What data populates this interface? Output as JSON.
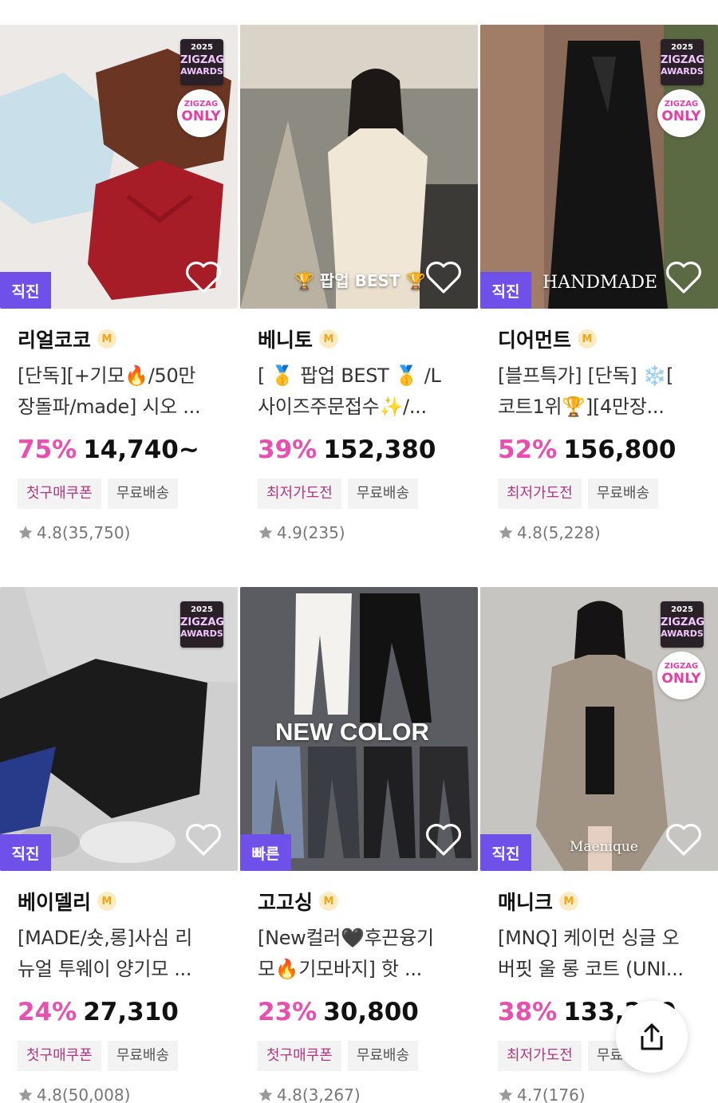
{
  "products": [
    {
      "store": "리얼코코",
      "title_lines": [
        "[단독][+기모🔥/50만",
        "장돌파/made] 시오 ..."
      ],
      "discount": "75%",
      "price": "14,740~",
      "tags": [
        "첫구매쿠폰",
        "무료배송"
      ],
      "rating": "4.8",
      "reviews": "(35,750)",
      "chip": "직진",
      "award": true,
      "only": true,
      "overlay": "",
      "image_theme": "sweaters"
    },
    {
      "store": "베니토",
      "title_lines": [
        "[ 🥇 팝업 BEST 🥇 /L",
        "사이즈주문접수✨/..."
      ],
      "discount": "39%",
      "price": "152,380",
      "tags": [
        "최저가도전",
        "무료배송"
      ],
      "rating": "4.9",
      "reviews": "(235)",
      "chip": "",
      "award": false,
      "only": false,
      "overlay": "🏆 팝업 BEST 🏆",
      "image_theme": "cream-coat"
    },
    {
      "store": "디어먼트",
      "title_lines": [
        "[블프특가] [단독] ❄️[",
        "코트1위🏆][4만장..."
      ],
      "discount": "52%",
      "price": "156,800",
      "tags": [
        "최저가도전",
        "무료배송"
      ],
      "rating": "4.8",
      "reviews": "(5,228)",
      "chip": "직진",
      "award": true,
      "only": true,
      "overlay": "HANDMADE",
      "image_theme": "black-coat"
    },
    {
      "store": "베이델리",
      "title_lines": [
        "[MADE/숏,롱]사심 리",
        "뉴얼 투웨이 양기모 ..."
      ],
      "discount": "24%",
      "price": "27,310",
      "tags": [
        "첫구매쿠폰",
        "무료배송"
      ],
      "rating": "4.8",
      "reviews": "(50,008)",
      "chip": "직진",
      "award": true,
      "only": false,
      "overlay": "",
      "image_theme": "jogger"
    },
    {
      "store": "고고싱",
      "title_lines": [
        "[New컬러🖤후끈융기",
        "모🔥기모바지] 핫 ..."
      ],
      "discount": "23%",
      "price": "30,800",
      "tags": [
        "첫구매쿠폰",
        "무료배송"
      ],
      "rating": "4.8",
      "reviews": "(3,267)",
      "chip": "빠른",
      "award": false,
      "only": false,
      "overlay": "NEW COLOR",
      "image_theme": "jeans"
    },
    {
      "store": "매니크",
      "title_lines": [
        "[MNQ] 케이먼 싱글 오",
        "버핏 울 롱 코트 (UNI..."
      ],
      "discount": "38%",
      "price": "133,230",
      "tags": [
        "최저가도전",
        "무료배송"
      ],
      "rating": "4.7",
      "reviews": "(176)",
      "chip": "직진",
      "award": true,
      "only": true,
      "overlay": "Maenique",
      "image_theme": "beige-coat"
    }
  ],
  "award_text": {
    "year": "2025",
    "line1": "ZIGZAG",
    "line2": "AWARDS"
  },
  "only_text": {
    "line1": "ZIGZAG",
    "line2": "ONLY"
  },
  "store_badge": "M",
  "icons": {
    "heart": "heart-outline-icon",
    "star": "star-icon",
    "share": "share-icon"
  },
  "colors": {
    "discount": "#e84fb0",
    "chip": "#6f50e8",
    "coupon_tag": "#b4387f"
  }
}
